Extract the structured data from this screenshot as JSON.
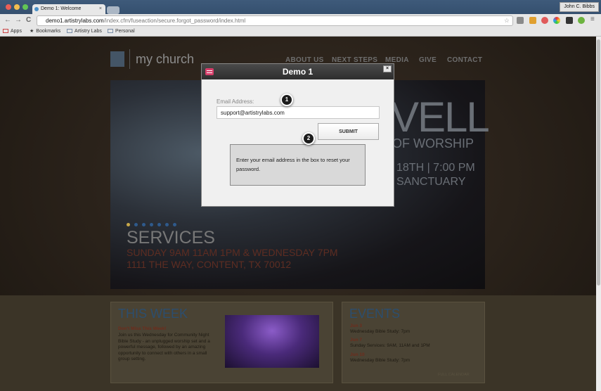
{
  "browser": {
    "tab_title": "Demo 1: Welcome",
    "tab_close": "×",
    "user_name": "John C. Bibbs",
    "url_host": "demo1.artistrylabs.com",
    "url_path": "/index.cfm/fuseaction/secure.forgot_password/index.html",
    "nav_back": "←",
    "nav_forward": "→",
    "nav_reload": "C",
    "star": "☆",
    "menu": "≡",
    "bookmarks": [
      {
        "label": "Apps"
      },
      {
        "label": "Bookmarks"
      },
      {
        "label": "Artistry Labs"
      },
      {
        "label": "Personal"
      }
    ]
  },
  "site": {
    "logo_text": "my church",
    "nav": [
      "ABOUT US",
      "NEXT STEPS",
      "MEDIA",
      "GIVE",
      "CONTACT"
    ],
    "hero_big": "VELL",
    "hero_of_worship": "OF WORSHIP",
    "hero_date": "18TH | 7:00 PM",
    "hero_place": "SANCTUARY",
    "services_title": "SERVICES",
    "services_times": "SUNDAY 9AM 11AM 1PM & WEDNESDAY 7PM",
    "services_address": "1111 THE WAY, CONTENT, TX 70012",
    "this_week": {
      "title": "THIS WEEK",
      "headline": "Don't Miss This Week!",
      "body": "Join us this Wednesday for Community Night Bible Study - an unplugged worship set and a powerful message, followed by an amazing opportunity to connect with others in a small group setting."
    },
    "events": {
      "title": "EVENTS",
      "items": [
        {
          "date": "Jun 3",
          "text": "Wednesday Bible Study: 7pm"
        },
        {
          "date": "Jun 7",
          "text": "Sunday Services: 9AM, 11AM and 1PM"
        },
        {
          "date": "Jun 10",
          "text": "Wednesday Bible Study: 7pm"
        }
      ],
      "full_calendar": "FULL CALENDAR"
    }
  },
  "modal": {
    "title": "Demo 1",
    "close": "×",
    "email_label": "Email Address:",
    "email_value": "support@artistrylabs.com",
    "submit_label": "SUBMIT",
    "hint": "Enter your email address in the box to reset your password."
  },
  "annotations": {
    "step1": "1",
    "step2": "2"
  },
  "colors": {
    "modal_header": "#3a3a3a",
    "modal_icon": "#d63e6a",
    "accent_blue": "#2c4e6e"
  }
}
